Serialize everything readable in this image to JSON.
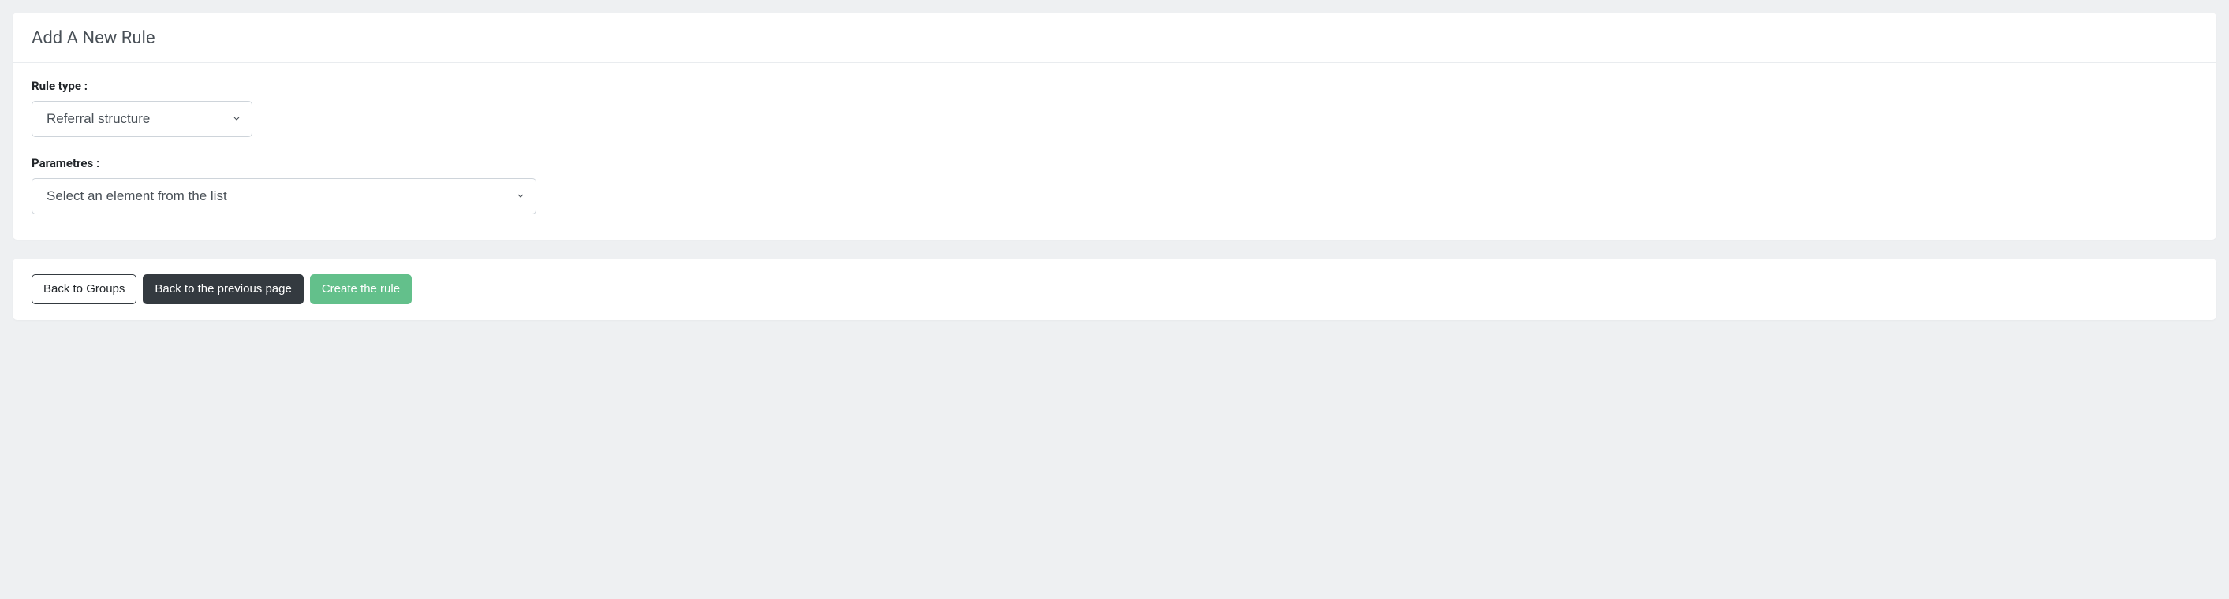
{
  "header": {
    "title": "Add A New Rule"
  },
  "form": {
    "rule_type": {
      "label": "Rule type :",
      "selected": "Referral structure"
    },
    "parametres": {
      "label": "Parametres :",
      "selected": "Select an element from the list"
    }
  },
  "buttons": {
    "back_to_groups": "Back to Groups",
    "back_previous": "Back to the previous page",
    "create_rule": "Create the rule"
  }
}
